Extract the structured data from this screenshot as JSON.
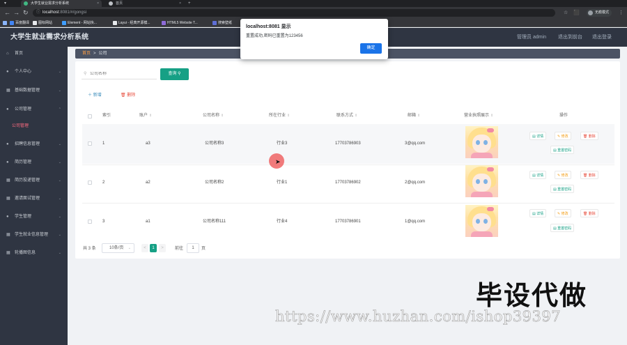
{
  "browser": {
    "tabs": [
      {
        "label": "大学生就业需求分析系统",
        "active": true
      },
      {
        "label": "首页",
        "active": false
      }
    ],
    "new_tab": "+",
    "url_host": "localhost",
    "url_path": ":8081/#/gongsi",
    "profile_label": "无痕模式",
    "bookmarks": [
      "百度翻译",
      "图标网站",
      "Element - 网站快...",
      "Layui - 经典开源模...",
      "HTML5 Website T...",
      "搜索壁纸"
    ]
  },
  "app": {
    "title": "大学生就业需求分析系统",
    "top_links": [
      "管理员 admin",
      "退出到前台",
      "退出登录"
    ]
  },
  "sidebar": {
    "items": [
      {
        "label": "首页",
        "icon": "home-icon",
        "arrow": false
      },
      {
        "label": "个人中心",
        "icon": "person-icon",
        "arrow": true
      },
      {
        "label": "基础数据管理",
        "icon": "grid-icon",
        "arrow": true
      },
      {
        "label": "公司管理",
        "icon": "person-icon",
        "arrow": true
      },
      {
        "label": "公司管理",
        "icon": "",
        "arrow": false,
        "sub": true
      },
      {
        "label": "招聘信息管理",
        "icon": "person-icon",
        "arrow": true
      },
      {
        "label": "简历管理",
        "icon": "person-icon",
        "arrow": true
      },
      {
        "label": "简历投递管理",
        "icon": "grid-icon",
        "arrow": true
      },
      {
        "label": "邀请面试管理",
        "icon": "grid-icon",
        "arrow": true
      },
      {
        "label": "学生管理",
        "icon": "person-icon",
        "arrow": true
      },
      {
        "label": "学生就业信息管理",
        "icon": "grid-icon",
        "arrow": true
      },
      {
        "label": "轮播图信息",
        "icon": "grid-icon",
        "arrow": true
      }
    ]
  },
  "breadcrumb": {
    "home": "首页",
    "separator": ">",
    "current": "公司"
  },
  "search": {
    "placeholder": "公司名称",
    "button": "查询"
  },
  "actions": {
    "add": "新增",
    "delete": "删除"
  },
  "table": {
    "headers": [
      "索引",
      "账户",
      "公司名称",
      "所在行业",
      "联系方式",
      "邮箱",
      "营业执照展示",
      "操作"
    ],
    "rows": [
      {
        "index": "1",
        "account": "a3",
        "name": "公司名称3",
        "industry": "行业3",
        "phone": "17703786903",
        "email": "3@qq.com"
      },
      {
        "index": "2",
        "account": "a2",
        "name": "公司名称2",
        "industry": "行业1",
        "phone": "17703786902",
        "email": "2@qq.com"
      },
      {
        "index": "3",
        "account": "a1",
        "name": "公司名称111",
        "industry": "行业4",
        "phone": "17703786901",
        "email": "1@qq.com"
      }
    ],
    "ops": {
      "detail": "详情",
      "edit": "修改",
      "delete": "删除",
      "reset": "重置密码"
    }
  },
  "pagination": {
    "total": "共 3 条",
    "page_size": "10条/页",
    "prev": "<",
    "current": "1",
    "next": ">",
    "goto_label": "前往",
    "goto_value": "1",
    "page_unit": "页"
  },
  "dialog": {
    "title": "localhost:8081 显示",
    "message": "重置成功,密码已重置为123456",
    "ok": "确定"
  },
  "watermark": {
    "cn": "毕设代做",
    "url": "https://www.huzhan.com/ishop39397"
  },
  "colors": {
    "accent": "#16a085",
    "danger": "#e74c3c",
    "sidebar": "#2f3542",
    "sub_active": "#ff6b81"
  }
}
